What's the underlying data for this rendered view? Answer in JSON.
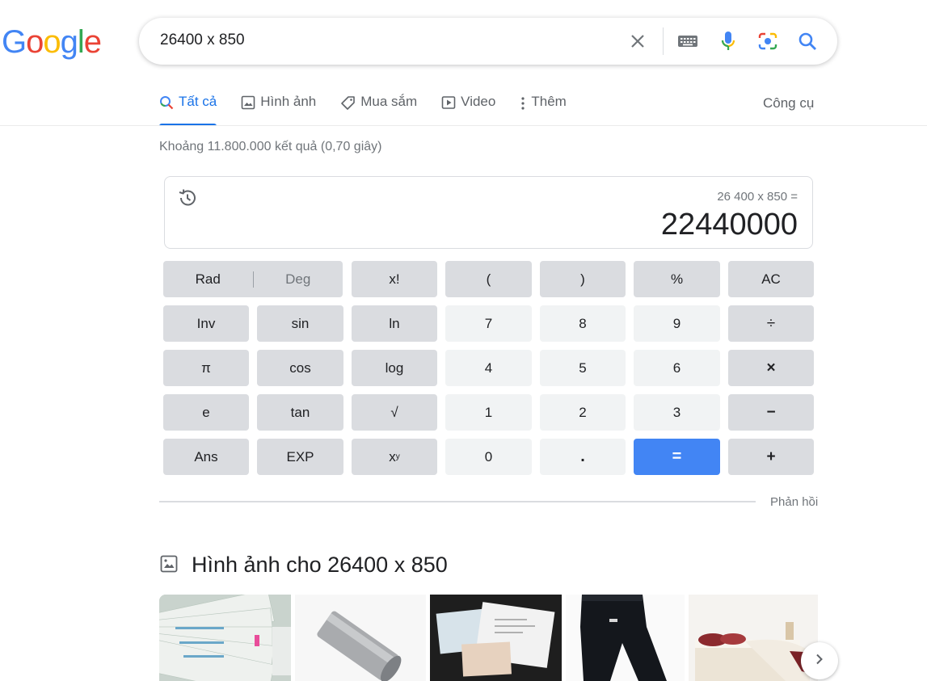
{
  "logo": {
    "letters": [
      "G",
      "o",
      "o",
      "g",
      "l",
      "e"
    ],
    "colors": [
      "#4285f4",
      "#ea4335",
      "#fbbc05",
      "#4285f4",
      "#34a853",
      "#ea4335"
    ]
  },
  "search": {
    "query": "26400 x 850"
  },
  "tabs": [
    {
      "label": "Tất cả",
      "icon": "search-icon",
      "active": true
    },
    {
      "label": "Hình ảnh",
      "icon": "image-icon"
    },
    {
      "label": "Mua sắm",
      "icon": "tag-icon"
    },
    {
      "label": "Video",
      "icon": "play-icon"
    },
    {
      "label": "Thêm",
      "icon": "more-vert-icon"
    }
  ],
  "tools_label": "Công cụ",
  "result_stats": "Khoảng 11.800.000 kết quả (0,70 giây)",
  "calculator": {
    "expression": "26 400 x 850 =",
    "result": "22440000",
    "rad": "Rad",
    "deg": "Deg",
    "keys": {
      "fact": "x!",
      "lparen": "(",
      "rparen": ")",
      "percent": "%",
      "ac": "AC",
      "inv": "Inv",
      "sin": "sin",
      "ln": "ln",
      "k7": "7",
      "k8": "8",
      "k9": "9",
      "div": "÷",
      "pi": "π",
      "cos": "cos",
      "log": "log",
      "k4": "4",
      "k5": "5",
      "k6": "6",
      "mul": "×",
      "e": "e",
      "tan": "tan",
      "sqrt": "√",
      "k1": "1",
      "k2": "2",
      "k3": "3",
      "minus": "−",
      "ans": "Ans",
      "exp": "EXP",
      "pow_base": "x",
      "pow_exp": "y",
      "k0": "0",
      "dot": ".",
      "eq": "=",
      "plus": "+"
    },
    "accent": "#4285f4"
  },
  "feedback_label": "Phản hồi",
  "images_heading": "Hình ảnh cho 26400 x 850"
}
